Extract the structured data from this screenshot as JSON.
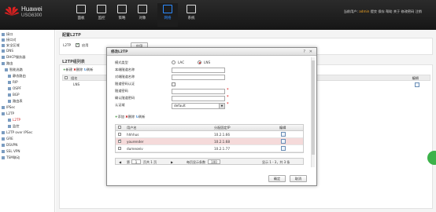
{
  "header": {
    "brand": "Huawei",
    "product": "USG6300",
    "nav": [
      {
        "label": "面板",
        "icon": "dashboard-icon"
      },
      {
        "label": "监控",
        "icon": "monitor-icon"
      },
      {
        "label": "策略",
        "icon": "policy-icon"
      },
      {
        "label": "对象",
        "icon": "object-icon"
      },
      {
        "label": "网络",
        "icon": "network-icon",
        "active": true
      },
      {
        "label": "系统",
        "icon": "system-icon"
      }
    ],
    "user_prefix": "当前用户:",
    "user": "admin",
    "links": "提交  保存  帮助  关于  修改密码  注销"
  },
  "sidebar": {
    "items": [
      {
        "label": "接口",
        "icon": "interface-icon"
      },
      {
        "label": "接口对",
        "icon": "interface-pair-icon"
      },
      {
        "label": "安全区域",
        "icon": "security-zone-icon"
      },
      {
        "label": "DNS",
        "icon": "dns-icon"
      },
      {
        "label": "DHCP服务器",
        "icon": "dhcp-icon"
      },
      {
        "label": "路由",
        "icon": "route-icon"
      },
      {
        "label": "智能选路",
        "icon": "smart-route-icon"
      },
      {
        "label": "静态路由",
        "icon": "static-route-icon"
      },
      {
        "label": "RIP",
        "icon": "rip-icon"
      },
      {
        "label": "OSPF",
        "icon": "ospf-icon"
      },
      {
        "label": "BGP",
        "icon": "bgp-icon"
      },
      {
        "label": "路由表",
        "icon": "route-table-icon"
      },
      {
        "label": "IPSec",
        "icon": "ipsec-icon"
      },
      {
        "label": "L2TP",
        "icon": "l2tp-icon"
      },
      {
        "label": "L2TP",
        "icon": "l2tp-sub-icon",
        "selected": true
      },
      {
        "label": "监控",
        "icon": "monitor-sub-icon"
      },
      {
        "label": "L2TP over IPSec",
        "icon": "l2tp-ipsec-icon"
      },
      {
        "label": "GRE",
        "icon": "gre-icon"
      },
      {
        "label": "DSVPN",
        "icon": "dsvpn-icon"
      },
      {
        "label": "SSL VPN",
        "icon": "sslvpn-icon"
      },
      {
        "label": "TSM联动",
        "icon": "tsm-icon"
      }
    ]
  },
  "main": {
    "config_title": "配置L2TP",
    "l2tp_label": "L2TP",
    "enable_label": "启用",
    "apply_label": "应用",
    "list_title": "L2TP组列表",
    "toolbar": {
      "add": "新建",
      "delete": "删除",
      "refresh": "刷新"
    },
    "table_header_group": "组名",
    "table_header_edit": "编辑",
    "row_group": "LNS"
  },
  "modal": {
    "title": "修改L2TP",
    "fields": {
      "mode_label": "模式类型",
      "mode_lac": "LAC",
      "mode_lns": "LNS",
      "local_tunnel_label": "本端隧道名称",
      "peer_tunnel_label": "对端隧道名称",
      "tunnel_auth_label": "隧道密码认证",
      "tunnel_pwd_label": "隧道密码",
      "confirm_pwd_label": "确认隧道密码",
      "auth_domain_label": "认证域",
      "auth_domain_value": "default"
    },
    "toolbar": {
      "add": "添加",
      "delete": "删除",
      "refresh": "刷新"
    },
    "columns": {
      "user": "用户名",
      "ip": "分配固定IP",
      "edit": "编辑"
    },
    "rows": [
      {
        "user": "hhhhus",
        "ip": "10.2.1.66",
        "checked": false
      },
      {
        "user": "yourender",
        "ip": "10.2.1.68",
        "checked": true
      },
      {
        "user": "dumeoeiv",
        "ip": "10.2.1.77",
        "checked": false
      }
    ],
    "pager": {
      "page_prefix": "第",
      "page_value": "1",
      "page_suffix": "页共 1 页",
      "per_page_label": "每页显示条数",
      "per_page_value": "100",
      "summary": "显示 1 - 3，共 3 条"
    },
    "ok_label": "确定",
    "cancel_label": "取消",
    "close_glyph": "✕",
    "help_glyph": "?"
  }
}
